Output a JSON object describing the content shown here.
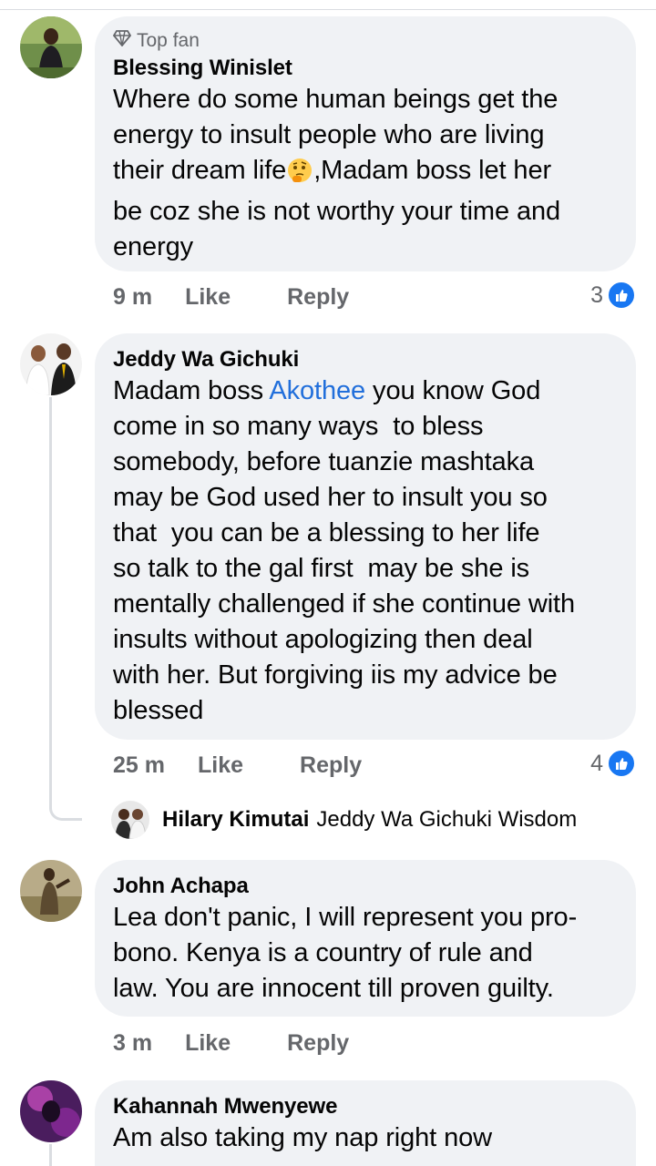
{
  "comments": [
    {
      "badge": "Top fan",
      "name": "Blessing Winislet",
      "text_before": "Where do some human beings get the\nenergy to insult people who are living\ntheir dream life",
      "emoji": "thinking-face-emoji",
      "text_after": ",Madam boss let her\nbe coz she is not worthy your time and\nenergy",
      "time": "9 m",
      "like": "Like",
      "reply": "Reply",
      "reactions": "3"
    },
    {
      "name": "Jeddy Wa Gichuki",
      "text_before": "Madam boss ",
      "mention": "Akothee",
      "text_after": " you know God\ncome in so many ways  to bless\nsomebody, before tuanzie mashtaka\nmay be God used her to insult you so\nthat  you can be a blessing to her life\nso talk to the gal first  may be she is\nmentally challenged if she continue with\ninsults without apologizing then deal\nwith her. But forgiving iis my advice be\nblessed",
      "time": "25 m",
      "like": "Like",
      "reply": "Reply",
      "reactions": "4",
      "reply_preview": {
        "name": "Hilary Kimutai",
        "text": "Jeddy Wa Gichuki Wisdom"
      }
    },
    {
      "name": "John Achapa",
      "text": "Lea don't panic, I will represent you pro-\nbono. Kenya is a country of rule and\nlaw. You are innocent till proven guilty.",
      "time": "3 m",
      "like": "Like",
      "reply": "Reply"
    },
    {
      "name": "Kahannah Mwenyewe",
      "text": "Am also taking my nap right now"
    }
  ],
  "colors": {
    "bubble": "#f0f2f5",
    "meta": "#65676b",
    "link": "#216fdb",
    "like_blue": "#1877f2"
  }
}
